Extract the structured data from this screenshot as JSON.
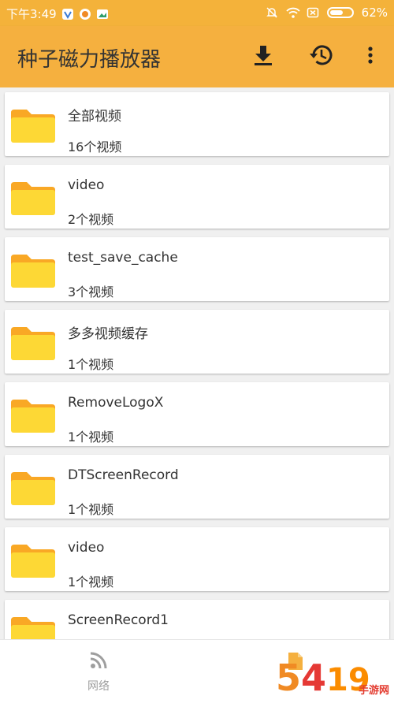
{
  "status_bar": {
    "time": "下午3:49",
    "battery_percent": "62%",
    "battery_level": 0.62
  },
  "app_bar": {
    "title": "种子磁力播放器",
    "icons": [
      "download-icon",
      "history-icon",
      "more-vert-icon"
    ]
  },
  "folders": [
    {
      "name": "全部视频",
      "count": "16个视频"
    },
    {
      "name": "video",
      "count": "2个视频"
    },
    {
      "name": "test_save_cache",
      "count": "3个视频"
    },
    {
      "name": "多多视频缓存",
      "count": "1个视频"
    },
    {
      "name": "RemoveLogoX",
      "count": "1个视频"
    },
    {
      "name": "DTScreenRecord",
      "count": "1个视频"
    },
    {
      "name": "video",
      "count": "1个视频"
    },
    {
      "name": "ScreenRecord1",
      "count": ""
    }
  ],
  "bottom_nav": {
    "tabs": [
      {
        "label": "网络",
        "icon": "rss-feed-icon"
      },
      {
        "label": "",
        "icon": "file-icon"
      }
    ]
  },
  "watermark": {
    "text": "手游网"
  },
  "colors": {
    "primary": "#f5b03f",
    "folder_body": "#fdd835",
    "folder_tab": "#f9a825",
    "inactive_tab": "#9e9e9e"
  }
}
